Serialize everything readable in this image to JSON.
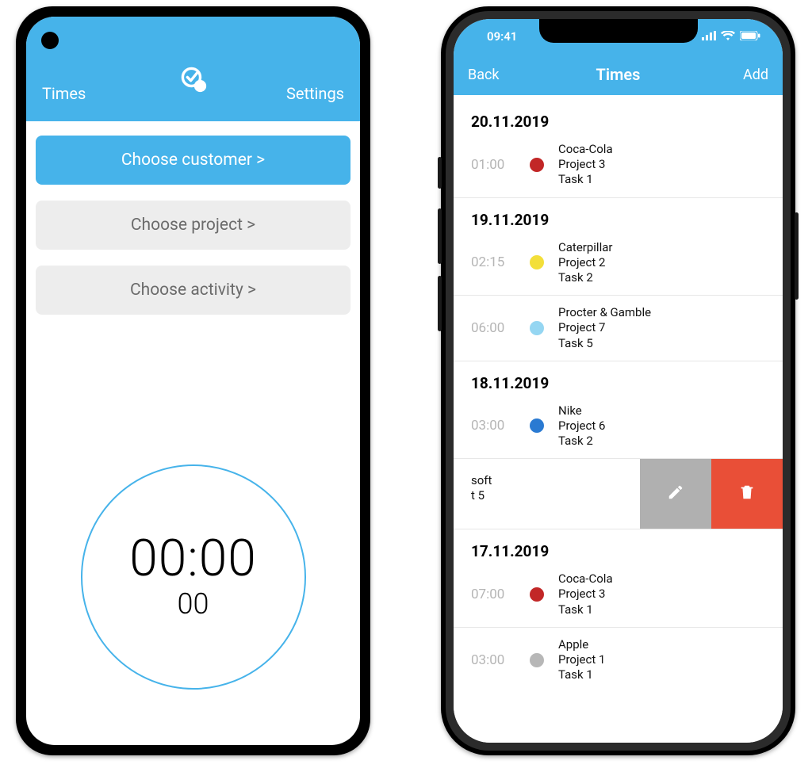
{
  "left": {
    "nav": {
      "left": "Times",
      "right": "Settings"
    },
    "buttons": {
      "customer": "Choose customer >",
      "project": "Choose project >",
      "activity": "Choose activity >"
    },
    "timer": {
      "main": "00:00",
      "sub": "00"
    }
  },
  "right": {
    "status": {
      "time": "09:41"
    },
    "nav": {
      "back": "Back",
      "title": "Times",
      "add": "Add"
    },
    "sections": [
      {
        "date": "20.11.2019",
        "entries": [
          {
            "duration": "01:00",
            "color": "#c22727",
            "customer": "Coca-Cola",
            "project": "Project 3",
            "task": "Task 1"
          }
        ]
      },
      {
        "date": "19.11.2019",
        "entries": [
          {
            "duration": "02:15",
            "color": "#f3df3a",
            "customer": "Caterpillar",
            "project": "Project 2",
            "task": "Task 2"
          },
          {
            "duration": "06:00",
            "color": "#95d6f2",
            "customer": "Procter & Gamble",
            "project": "Project 7",
            "task": "Task 5"
          }
        ]
      },
      {
        "date": "18.11.2019",
        "entries": [
          {
            "duration": "03:00",
            "color": "#2a7ad2",
            "customer": "Nike",
            "project": "Project 6",
            "task": "Task 2"
          }
        ],
        "swiped": {
          "line1": "soft",
          "line2": "t 5"
        }
      },
      {
        "date": "17.11.2019",
        "entries": [
          {
            "duration": "07:00",
            "color": "#c22727",
            "customer": "Coca-Cola",
            "project": "Project 3",
            "task": "Task 1"
          },
          {
            "duration": "03:00",
            "color": "#b7b7b7",
            "customer": "Apple",
            "project": "Project 1",
            "task": "Task 1"
          }
        ]
      }
    ]
  }
}
